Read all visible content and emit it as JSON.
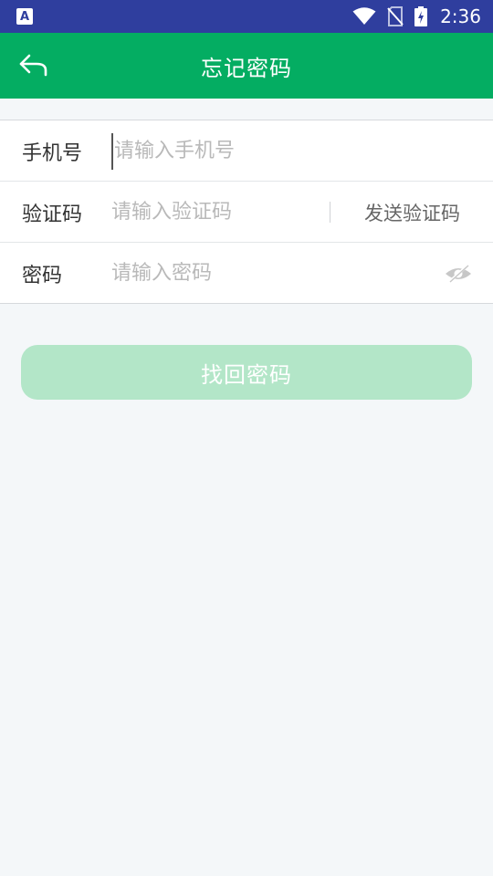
{
  "status_bar": {
    "time": "2:36",
    "notification_icon": "a-letter-icon",
    "icons": [
      "wifi-icon",
      "no-sim-icon",
      "battery-charging-icon"
    ]
  },
  "app_bar": {
    "title": "忘记密码",
    "back_icon": "back-arrow-icon"
  },
  "form": {
    "phone": {
      "label": "手机号",
      "placeholder": "请输入手机号",
      "value": ""
    },
    "code": {
      "label": "验证码",
      "placeholder": "请输入验证码",
      "value": "",
      "send_label": "发送验证码"
    },
    "password": {
      "label": "密码",
      "placeholder": "请输入密码",
      "value": "",
      "toggle_icon": "eye-hidden-icon"
    }
  },
  "submit": {
    "label": "找回密码"
  },
  "colors": {
    "status_bar": "#2f3e9e",
    "accent": "#04ad62",
    "button_disabled": "#b3e6c8",
    "page_bg": "#f4f7f9"
  }
}
